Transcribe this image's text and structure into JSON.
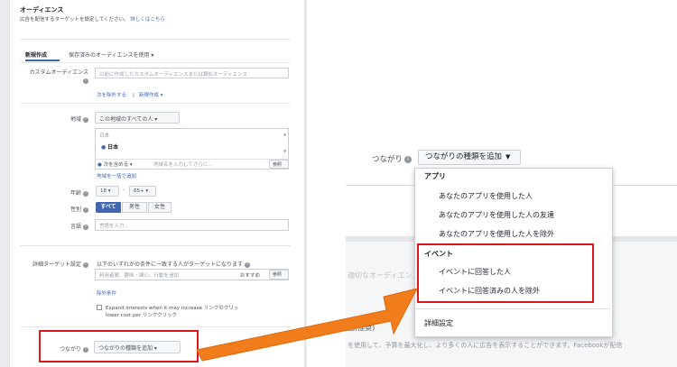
{
  "left": {
    "section_title": "オーディエンス",
    "section_desc": "広告を配信するターゲットを設定してください。",
    "learn_more": "詳しくはこちら",
    "tabs": [
      "新規作成",
      "保存済みのオーディエンスを使用 ▾"
    ],
    "custom_audience_label": "カスタムオーディエンス",
    "custom_audience_placeholder": "以前に作成したカスタムオーディエンスまたは類似オーディエンス",
    "exclude_link": "次を除外する:",
    "create_new_link": "新規作成 ▾",
    "location_label": "地域",
    "location_select": "この地域のすべての人 ▾",
    "country": "日本",
    "location_selected": "日本",
    "include_select": "次を含める ▾",
    "location_placeholder": "地域名を入力してさらに...",
    "browse_button": "参照",
    "bulk_add_link": "地域を一括で追加",
    "age_label": "年齢",
    "age_min": "18 ▾",
    "age_dash": "-",
    "age_max": "65+ ▾",
    "gender_label": "性別",
    "gender_options": [
      "すべて",
      "男性",
      "女性"
    ],
    "language_label": "言語",
    "language_placeholder": "言語を入力...",
    "detailed_label": "詳細ターゲット設定",
    "detailed_desc": "以下のいずれかの条件に一致する人がターゲットになります",
    "detailed_placeholder": "利用者層、趣味・関心、行動を追加",
    "suggest_button": "おすすめ",
    "browse_button2": "参照",
    "exclude_conditions_link": "除外条件",
    "expand_text_1": "Expand interests when it may increase リンクのクリッ",
    "expand_text_2": "lower cost per リンククリック",
    "connections_label": "つながり",
    "connections_button": "つながりの種類を追加 ▾"
  },
  "right": {
    "connections_label": "つながり",
    "connections_button": "つながりの種類を追加",
    "bg_text_1": "適切なオーディエンスを見つけ...",
    "bg_text_2": "囲(推奨)",
    "bg_text_3": "を使用して、予算を最大化し、より多くの人に広告を表示することができます。Facebookが配信",
    "dropdown": {
      "app_heading": "アプリ",
      "app_items": [
        "あなたのアプリを使用した人",
        "あなたのアプリを使用した人の友達",
        "あなたのアプリを使用した人を除外"
      ],
      "event_heading": "イベント",
      "event_items": [
        "イベントに回答した人",
        "イベントに回答済みの人を除外"
      ],
      "advanced": "詳細設定"
    }
  },
  "colors": {
    "highlight": "#e0141c",
    "arrow": "#f07c1c",
    "primary": "#4267b2"
  }
}
